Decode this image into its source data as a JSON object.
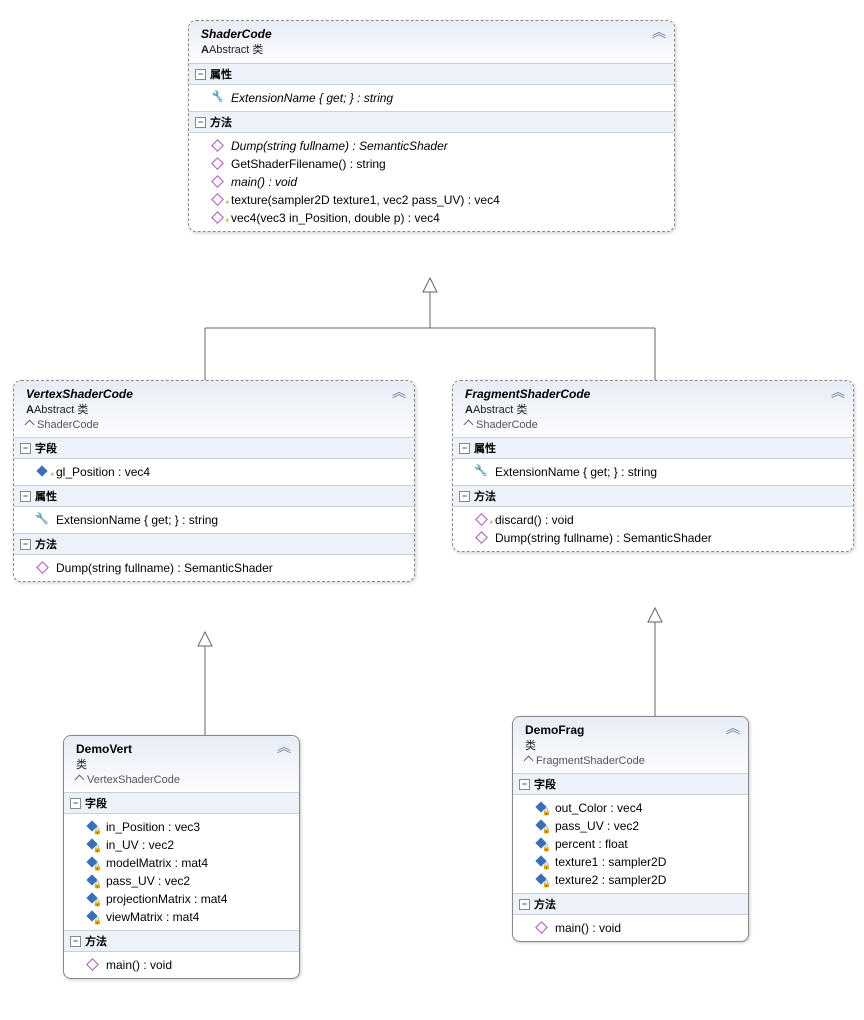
{
  "classes": {
    "shaderCode": {
      "title": "ShaderCode",
      "stereotype": "Abstract 类",
      "sections": [
        {
          "kind": "props",
          "label": "属性",
          "members": [
            {
              "icon": "prop",
              "text": "ExtensionName { get; } : string",
              "italic": true
            }
          ]
        },
        {
          "kind": "methods",
          "label": "方法",
          "members": [
            {
              "icon": "method",
              "text": "Dump(string fullname) : SemanticShader",
              "italic": true
            },
            {
              "icon": "method",
              "text": "GetShaderFilename() : string"
            },
            {
              "icon": "method",
              "text": "main() : void",
              "italic": true
            },
            {
              "icon": "method",
              "text": "texture(sampler2D texture1, vec2 pass_UV) : vec4",
              "star": true
            },
            {
              "icon": "method",
              "text": "vec4(vec3 in_Position, double p) : vec4",
              "star": true
            }
          ]
        }
      ]
    },
    "vertexShaderCode": {
      "title": "VertexShaderCode",
      "stereotype": "Abstract 类",
      "inherits": "ShaderCode",
      "sections": [
        {
          "kind": "fields",
          "label": "字段",
          "members": [
            {
              "icon": "field",
              "text": "gl_Position : vec4",
              "star": true
            }
          ]
        },
        {
          "kind": "props",
          "label": "属性",
          "members": [
            {
              "icon": "prop",
              "text": "ExtensionName { get; } : string"
            }
          ]
        },
        {
          "kind": "methods",
          "label": "方法",
          "members": [
            {
              "icon": "method",
              "text": "Dump(string fullname) : SemanticShader"
            }
          ]
        }
      ]
    },
    "fragmentShaderCode": {
      "title": "FragmentShaderCode",
      "stereotype": "Abstract 类",
      "inherits": "ShaderCode",
      "sections": [
        {
          "kind": "props",
          "label": "属性",
          "members": [
            {
              "icon": "prop",
              "text": "ExtensionName { get; } : string"
            }
          ]
        },
        {
          "kind": "methods",
          "label": "方法",
          "members": [
            {
              "icon": "method",
              "text": "discard() : void",
              "star": true
            },
            {
              "icon": "method",
              "text": "Dump(string fullname) : SemanticShader"
            }
          ]
        }
      ]
    },
    "demoVert": {
      "title": "DemoVert",
      "stereotype": "类",
      "inherits": "VertexShaderCode",
      "sections": [
        {
          "kind": "fields",
          "label": "字段",
          "members": [
            {
              "icon": "field",
              "text": "in_Position : vec3",
              "lock": true
            },
            {
              "icon": "field",
              "text": "in_UV : vec2",
              "lock": true
            },
            {
              "icon": "field",
              "text": "modelMatrix : mat4",
              "lock": true
            },
            {
              "icon": "field",
              "text": "pass_UV : vec2",
              "lock": true
            },
            {
              "icon": "field",
              "text": "projectionMatrix : mat4",
              "lock": true
            },
            {
              "icon": "field",
              "text": "viewMatrix : mat4",
              "lock": true
            }
          ]
        },
        {
          "kind": "methods",
          "label": "方法",
          "members": [
            {
              "icon": "method",
              "text": "main() : void"
            }
          ]
        }
      ]
    },
    "demoFrag": {
      "title": "DemoFrag",
      "stereotype": "类",
      "inherits": "FragmentShaderCode",
      "sections": [
        {
          "kind": "fields",
          "label": "字段",
          "members": [
            {
              "icon": "field",
              "text": "out_Color : vec4",
              "lock": true
            },
            {
              "icon": "field",
              "text": "pass_UV : vec2",
              "lock": true
            },
            {
              "icon": "field",
              "text": "percent : float",
              "lock": true
            },
            {
              "icon": "field",
              "text": "texture1 : sampler2D",
              "lock": true
            },
            {
              "icon": "field",
              "text": "texture2 : sampler2D",
              "lock": true
            }
          ]
        },
        {
          "kind": "methods",
          "label": "方法",
          "members": [
            {
              "icon": "method",
              "text": "main() : void"
            }
          ]
        }
      ]
    }
  },
  "relations": [
    {
      "from": "vertexShaderCode",
      "to": "shaderCode",
      "type": "inherit"
    },
    {
      "from": "fragmentShaderCode",
      "to": "shaderCode",
      "type": "inherit"
    },
    {
      "from": "demoVert",
      "to": "vertexShaderCode",
      "type": "inherit"
    },
    {
      "from": "demoFrag",
      "to": "fragmentShaderCode",
      "type": "inherit"
    }
  ]
}
